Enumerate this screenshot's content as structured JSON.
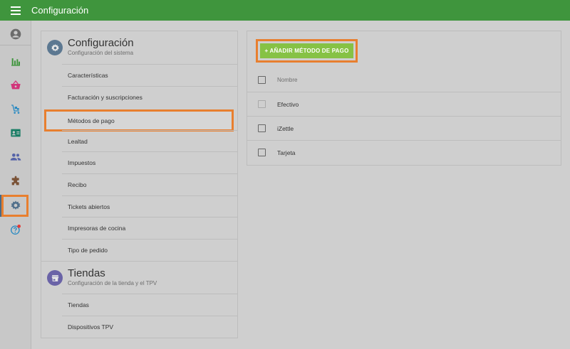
{
  "header": {
    "title": "Configuración",
    "menu_icon": "hamburger-menu-icon"
  },
  "sidebar": {
    "items": [
      {
        "icon": "account-circle-icon",
        "color": "#6b6b6b"
      },
      {
        "icon": "bar-chart-icon",
        "color": "#3f953d"
      },
      {
        "icon": "basket-icon",
        "color": "#d2357a"
      },
      {
        "icon": "cart-items-icon",
        "color": "#2a8ac2"
      },
      {
        "icon": "employee-badge-icon",
        "color": "#1a7e66"
      },
      {
        "icon": "people-icon",
        "color": "#5563a8"
      },
      {
        "icon": "puzzle-icon",
        "color": "#7a5236"
      },
      {
        "icon": "settings-gear-icon",
        "color": "#52708c"
      },
      {
        "icon": "help-icon",
        "color": "#2a8ac2"
      }
    ],
    "selected_index": 7
  },
  "settings": {
    "title": "Configuración",
    "subtitle": "Configuración del sistema",
    "items": [
      "Características",
      "Facturación y suscripciones",
      "Métodos de pago",
      "Lealtad",
      "Impuestos",
      "Recibo",
      "Tickets abiertos",
      "Impresoras de cocina",
      "Tipo de pedido"
    ],
    "selected_index": 2
  },
  "stores": {
    "title": "Tiendas",
    "subtitle": "Configuración de la tienda y el TPV",
    "items": [
      "Tiendas",
      "Dispositivos TPV"
    ]
  },
  "payments": {
    "add_label": "+ AÑADIR MÉTODO DE PAGO",
    "column_header": "Nombre",
    "rows": [
      "Efectivo",
      "iZettle",
      "Tarjeta"
    ]
  },
  "colors": {
    "topbar": "#3f953d",
    "accent_highlight": "#e87f2f",
    "add_button": "#86c245"
  }
}
